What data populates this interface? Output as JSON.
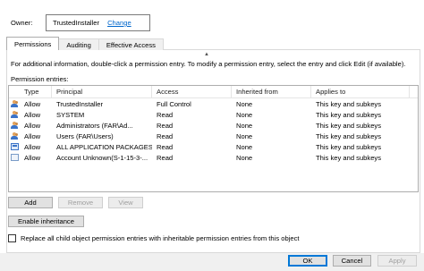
{
  "owner": {
    "label": "Owner:",
    "name": "TrustedInstaller",
    "change_link": "Change"
  },
  "tabs": [
    {
      "label": "Permissions",
      "active": true
    },
    {
      "label": "Auditing",
      "active": false
    },
    {
      "label": "Effective Access",
      "active": false
    }
  ],
  "scroll_indicator": "▲",
  "info_text": "For additional information, double-click a permission entry. To modify a permission entry, select the entry and click Edit (if available).",
  "entries_label": "Permission entries:",
  "columns": {
    "type": "Type",
    "principal": "Principal",
    "access": "Access",
    "inherited": "Inherited from",
    "applies": "Applies to"
  },
  "entries": [
    {
      "icon": "users-icon",
      "type": "Allow",
      "principal": "TrustedInstaller",
      "access": "Full Control",
      "inherited": "None",
      "applies": "This key and subkeys"
    },
    {
      "icon": "users-icon",
      "type": "Allow",
      "principal": "SYSTEM",
      "access": "Read",
      "inherited": "None",
      "applies": "This key and subkeys"
    },
    {
      "icon": "users-icon",
      "type": "Allow",
      "principal": "Administrators (FAR\\Ad...",
      "access": "Read",
      "inherited": "None",
      "applies": "This key and subkeys"
    },
    {
      "icon": "users-icon",
      "type": "Allow",
      "principal": "Users (FAR\\Users)",
      "access": "Read",
      "inherited": "None",
      "applies": "This key and subkeys"
    },
    {
      "icon": "app-package-icon",
      "type": "Allow",
      "principal": "ALL APPLICATION PACKAGES",
      "access": "Read",
      "inherited": "None",
      "applies": "This key and subkeys"
    },
    {
      "icon": "unknown-account-icon",
      "type": "Allow",
      "principal": "Account Unknown(S-1-15-3-...",
      "access": "Read",
      "inherited": "None",
      "applies": "This key and subkeys"
    }
  ],
  "buttons": {
    "add": "Add",
    "remove": "Remove",
    "view": "View",
    "enable_inheritance": "Enable inheritance",
    "ok": "OK",
    "cancel": "Cancel",
    "apply": "Apply"
  },
  "replace_checkbox": {
    "label": "Replace all child object permission entries with inheritable permission entries from this object",
    "checked": false
  },
  "colors": {
    "link": "#0066cc",
    "default_button_border": "#0078d7",
    "disabled_text": "#a0a0a0"
  }
}
